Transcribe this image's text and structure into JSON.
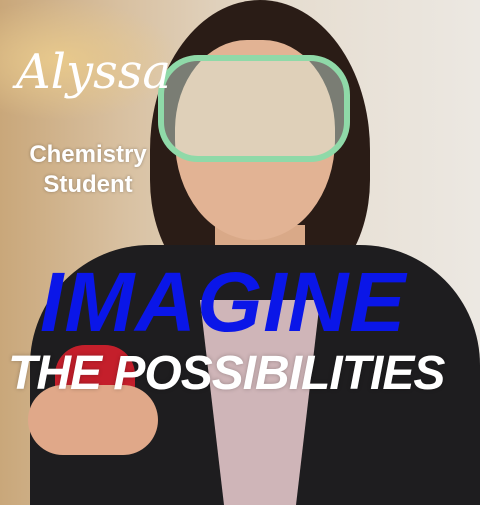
{
  "poster": {
    "name": "Alyssa",
    "role_line1": "Chemistry",
    "role_line2": "Student",
    "headline": "IMAGINE",
    "subheadline": "THE POSSIBILITIES"
  },
  "colors": {
    "headline": "#0a16e8",
    "text": "#ffffff"
  }
}
